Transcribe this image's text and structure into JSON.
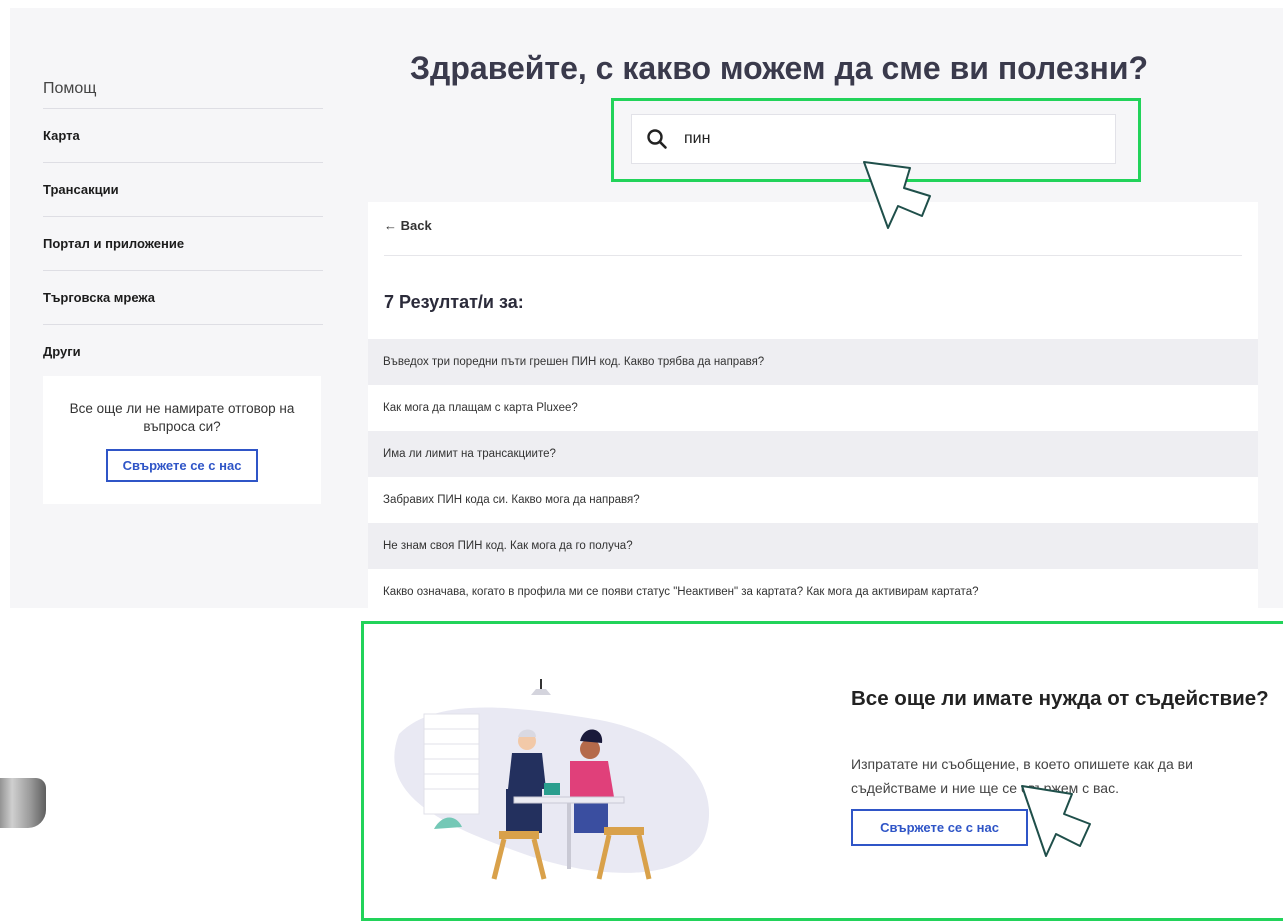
{
  "sidebar": {
    "title": "Помощ",
    "items": [
      {
        "label": "Карта"
      },
      {
        "label": "Трансакции"
      },
      {
        "label": "Портал и приложение"
      },
      {
        "label": "Търговска мрежа"
      },
      {
        "label": "Други"
      }
    ],
    "help_box": {
      "text": "Все още ли не намирате отговор на въпроса си?",
      "button": "Свържете се с нас"
    }
  },
  "header": {
    "title": "Здравейте, с какво можем да сме ви полезни?"
  },
  "search": {
    "value": "пин",
    "icon": "search-icon"
  },
  "results": {
    "back_label": "← Back",
    "heading": "7 Резултат/и за:",
    "items": [
      {
        "text": "Въведох три поредни пъти грешен ПИН код. Какво трябва да направя?"
      },
      {
        "text": "Как мога да плащам с карта Pluxee?"
      },
      {
        "text": "Има ли лимит на трансакциите?"
      },
      {
        "text": "Забравих ПИН кода си. Какво мога да направя?"
      },
      {
        "text": "Не знам своя ПИН код. Как мога да го получа?"
      },
      {
        "text": "Какво означава, когато в профила ми се появи статус \"Неактивен\" за картата? Как мога да активирам картата?"
      }
    ]
  },
  "cta": {
    "title": "Все още ли имате нужда от съдействие?",
    "description": "Изпратате ни съобщение, в което опишете как да ви съдействаме и ние ще се свържем с вас.",
    "button": "Свържете се с нас"
  },
  "colors": {
    "accent_blue": "#2f55c7",
    "highlight_green": "#22d35a",
    "heading": "#3a3a4c",
    "row_shade": "#eeeef2"
  }
}
